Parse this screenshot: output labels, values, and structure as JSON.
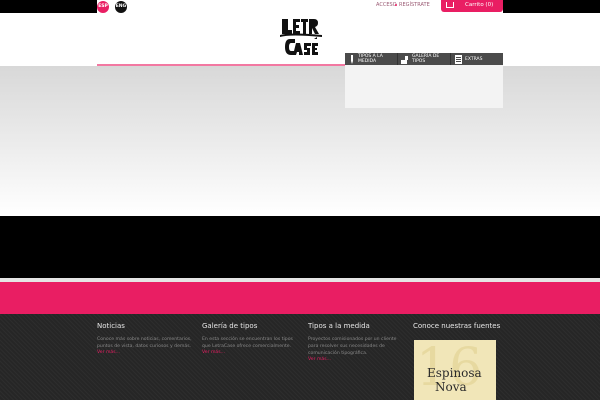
{
  "languages": [
    "ESP",
    "ENG"
  ],
  "top_links": {
    "acceso": "ACCESO",
    "registrate": "REGÍSTRATE"
  },
  "cart": {
    "label": "Carrito (0)"
  },
  "logo": {
    "text": "LETRA CASE"
  },
  "nav": [
    {
      "label": "TIPOS A LA MEDIDA",
      "icon": "pencil-icon"
    },
    {
      "label": "GALERÍA DE TIPOS",
      "icon": "stamp-icon"
    },
    {
      "label": "EXTRAS",
      "icon": "document-icon"
    }
  ],
  "footer": {
    "cols": [
      {
        "title": "Noticias",
        "text": "Conoce más sobre noticias, comentarios, puntos de vista, datos curiosos y demás.",
        "more": "Ver más..."
      },
      {
        "title": "Galería de tipos",
        "text": "En esta sección se encuentran los tipos que LetraCase ofrece comercialmente.",
        "more": "Ver más..."
      },
      {
        "title": "Tipos a la medida",
        "text": "Proyectos comisionados por un cliente para resolver sus necesidades de comunicación tipográfica.",
        "more": "Ver más..."
      },
      {
        "title": "Conoce nuestras fuentes"
      }
    ],
    "font_sample": {
      "name_line1": "Espinosa",
      "name_line2": "Nova",
      "number": "16"
    }
  },
  "colors": {
    "accent": "#e91e63",
    "dark": "#262626"
  }
}
